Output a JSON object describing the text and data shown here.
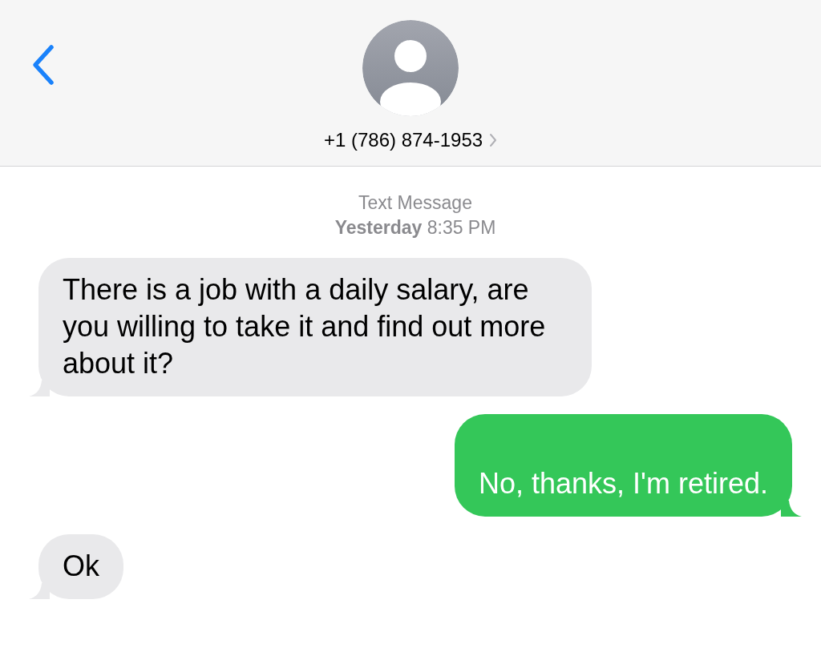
{
  "header": {
    "contact": "+1 (786) 874-1953"
  },
  "thread": {
    "service": "Text Message",
    "timestamp": "**Yesterday** 8:35 PM"
  },
  "messages": [
    {
      "kind": "received",
      "text": "There is a job with a daily salary, are you willing to take it and find out more about it?"
    },
    {
      "kind": "sent",
      "text": "No, thanks, I'm retired."
    },
    {
      "kind": "received",
      "text": "Ok"
    }
  ]
}
